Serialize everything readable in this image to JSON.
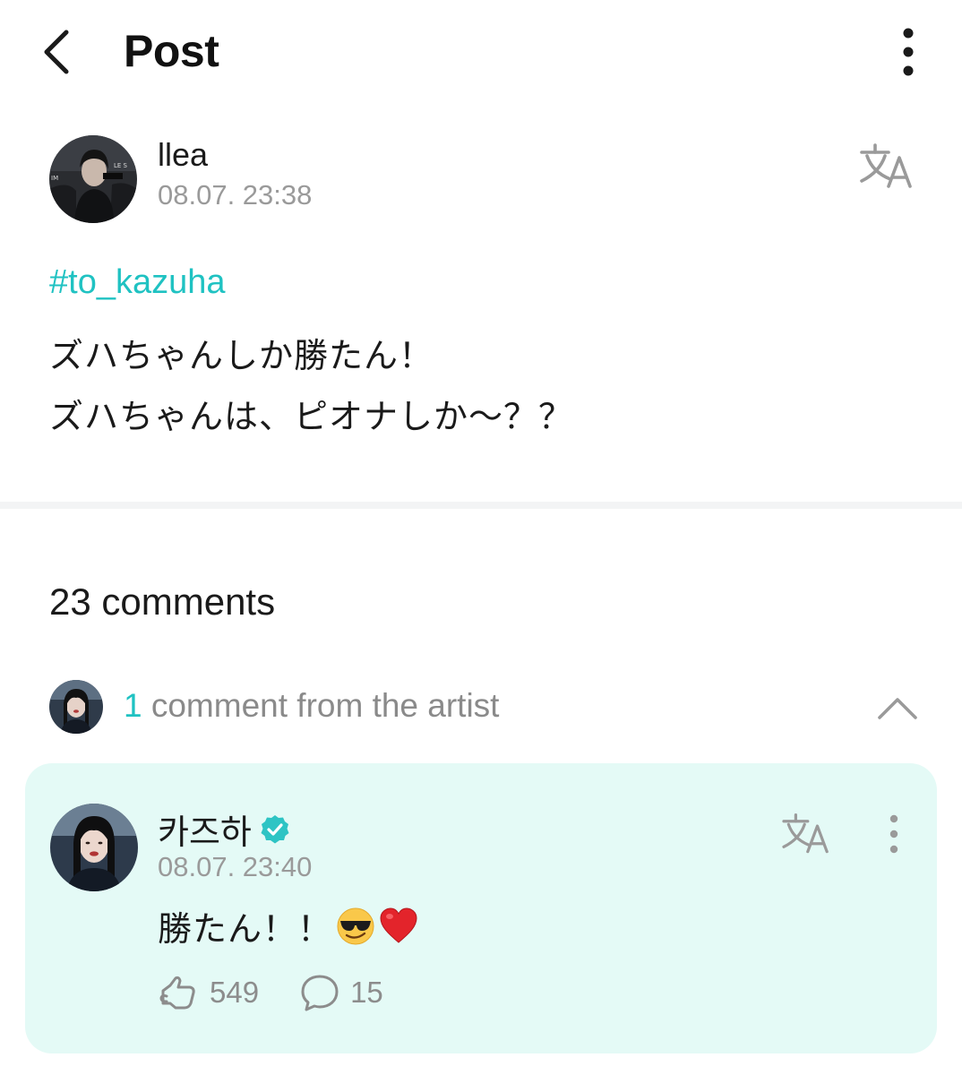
{
  "header": {
    "title": "Post",
    "back_icon": "chevron-left-icon",
    "menu_icon": "more-vertical-icon"
  },
  "post": {
    "author": "llea",
    "time": "08.07. 23:38",
    "hashtag": "#to_kazuha",
    "lines": [
      "ズハちゃんしか勝たん！",
      "ズハちゃんは、ピオナしか〜？？"
    ],
    "translate_icon": "translate-icon"
  },
  "comments": {
    "count_label": "23 comments",
    "artist_count": "1",
    "artist_label": " comment from the artist",
    "collapse_icon": "chevron-up-icon"
  },
  "artist_comment": {
    "name": "카즈하",
    "time": "08.07. 23:40",
    "text": "勝たん！！",
    "emojis": [
      "smiling-face-with-sunglasses",
      "red-heart"
    ],
    "likes": "549",
    "replies": "15"
  },
  "colors": {
    "accent": "#1fc2c2",
    "card_bg": "#e4faf6",
    "muted": "#9a9a9a"
  }
}
